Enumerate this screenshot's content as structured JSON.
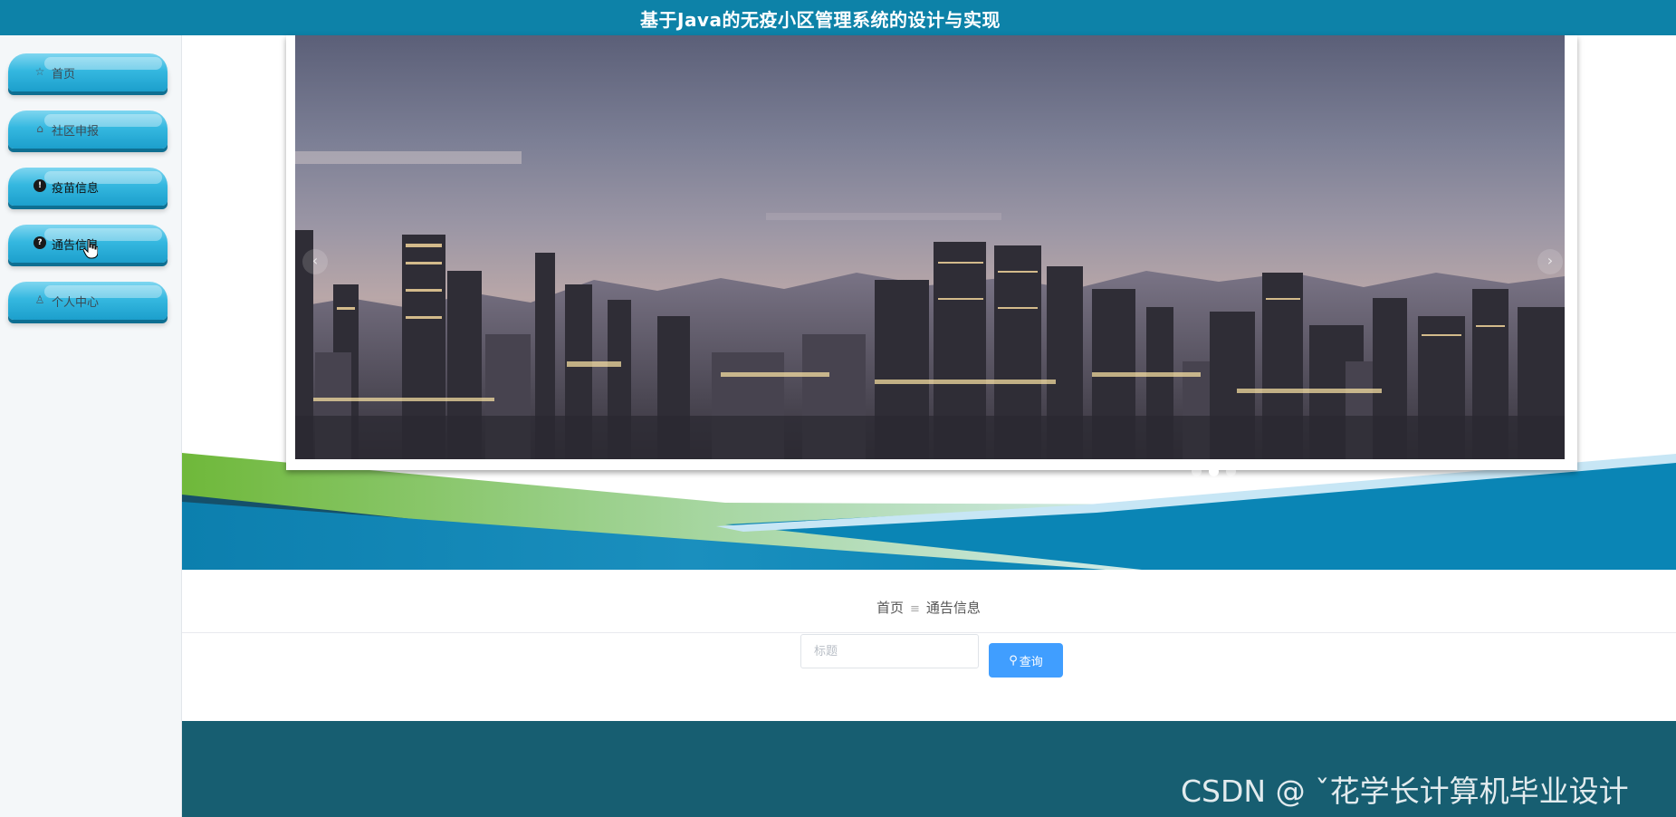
{
  "header": {
    "title": "基于Java的无疫小区管理系统的设计与实现"
  },
  "sidebar": {
    "items": [
      {
        "label": "首页",
        "icon": "home-icon"
      },
      {
        "label": "社区申报",
        "icon": "bag-icon"
      },
      {
        "label": "疫苗信息",
        "icon": "info-circle-icon"
      },
      {
        "label": "通告信息",
        "icon": "question-circle-icon"
      },
      {
        "label": "个人中心",
        "icon": "user-icon"
      }
    ]
  },
  "carousel": {
    "prev_arrow": "‹",
    "next_arrow": "›",
    "active_index": 1,
    "slide_count": 3
  },
  "breadcrumb": {
    "home": "首页",
    "separator": "≡",
    "current": "通告信息"
  },
  "search": {
    "placeholder": "标题",
    "button_label": "查询"
  },
  "watermark": "CSDN @ ˇ花学长计算机毕业设计",
  "colors": {
    "header_bg": "#0d82a8",
    "nav_button": "#35b8e0",
    "search_button": "#409eff",
    "footer_bg": "#175e71",
    "banner_green": "#7bbd3c",
    "banner_blue": "#0a85b5"
  }
}
